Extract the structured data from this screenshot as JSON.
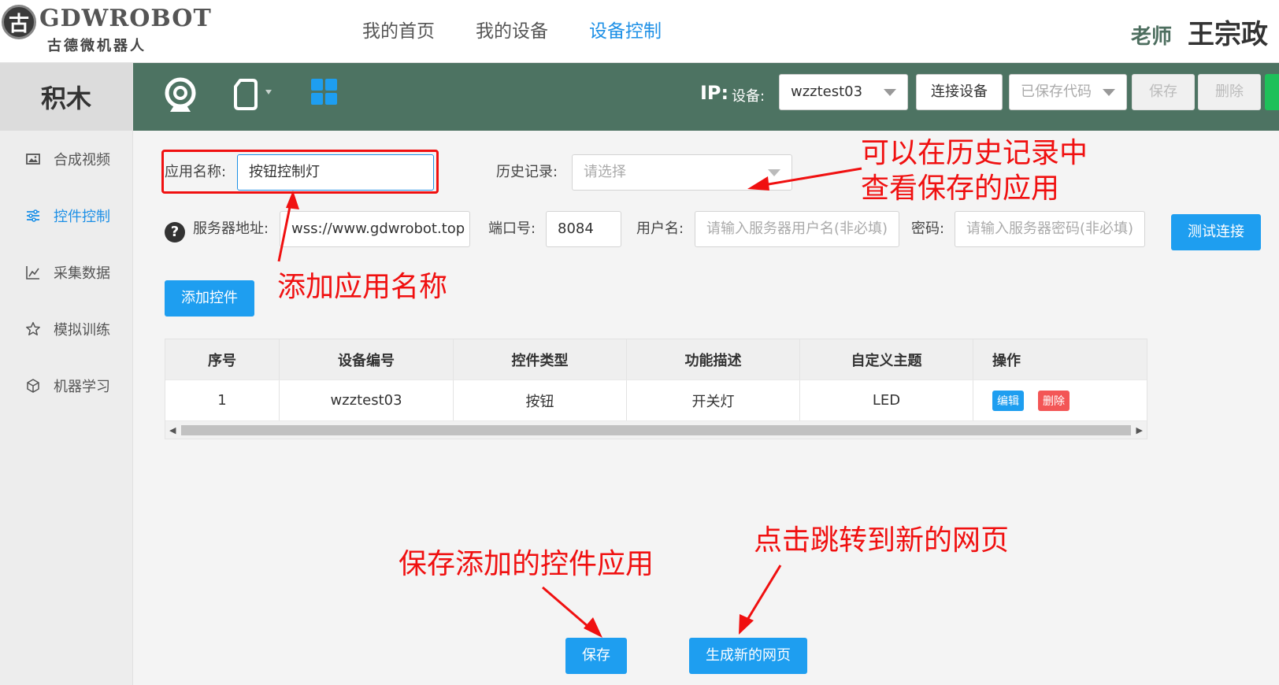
{
  "brand": {
    "logo_glyph": "古",
    "title": "GDWROBOT",
    "subtitle": "古德微机器人"
  },
  "nav": {
    "items": [
      "我的首页",
      "我的设备",
      "设备控制"
    ],
    "active_index": 2
  },
  "user": {
    "role": "老师",
    "name": "王宗政"
  },
  "sidebar": {
    "title": "积木",
    "items": [
      {
        "label": "合成视频",
        "icon": "image-icon",
        "active": false
      },
      {
        "label": "控件控制",
        "icon": "sliders-icon",
        "active": true
      },
      {
        "label": "采集数据",
        "icon": "chart-icon",
        "active": false
      },
      {
        "label": "模拟训练",
        "icon": "star-icon",
        "active": false
      },
      {
        "label": "机器学习",
        "icon": "cube-icon",
        "active": false
      }
    ]
  },
  "toolbar": {
    "ip_label": "IP:",
    "device_label": "设备:",
    "device_value": "wzztest03",
    "connect_label": "连接设备",
    "saved_code_placeholder": "已保存代码",
    "save_label": "保存",
    "delete_label": "删除"
  },
  "form": {
    "app_name_label": "应用名称:",
    "app_name_value": "按钮控制灯",
    "history_label": "历史记录:",
    "history_placeholder": "请选择",
    "server_label": "服务器地址:",
    "server_value": "wss://www.gdwrobot.top",
    "port_label": "端口号:",
    "port_value": "8084",
    "username_label": "用户名:",
    "username_placeholder": "请输入服务器用户名(非必填)",
    "password_label": "密码:",
    "password_placeholder": "请输入服务器密码(非必填)",
    "test_button": "测试连接",
    "add_button": "添加控件"
  },
  "table": {
    "headers": [
      "序号",
      "设备编号",
      "控件类型",
      "功能描述",
      "自定义主题",
      "操作"
    ],
    "rows": [
      {
        "index": "1",
        "device": "wzztest03",
        "type": "按钮",
        "desc": "开关灯",
        "topic": "LED",
        "edit": "编辑",
        "delete": "删除"
      }
    ]
  },
  "bottom": {
    "save_button": "保存",
    "generate_button": "生成新的网页"
  },
  "annotations": {
    "history_note": [
      "可以在历史记录中",
      "查看保存的应用"
    ],
    "name_note": "添加应用名称",
    "save_note": "保存添加的控件应用",
    "generate_note": "点击跳转到新的网页"
  },
  "colors": {
    "accent": "#1e90e6",
    "toolbar_green": "#4d7362",
    "annotation_red": "#f01010",
    "button_blue": "#1e9ef0"
  }
}
